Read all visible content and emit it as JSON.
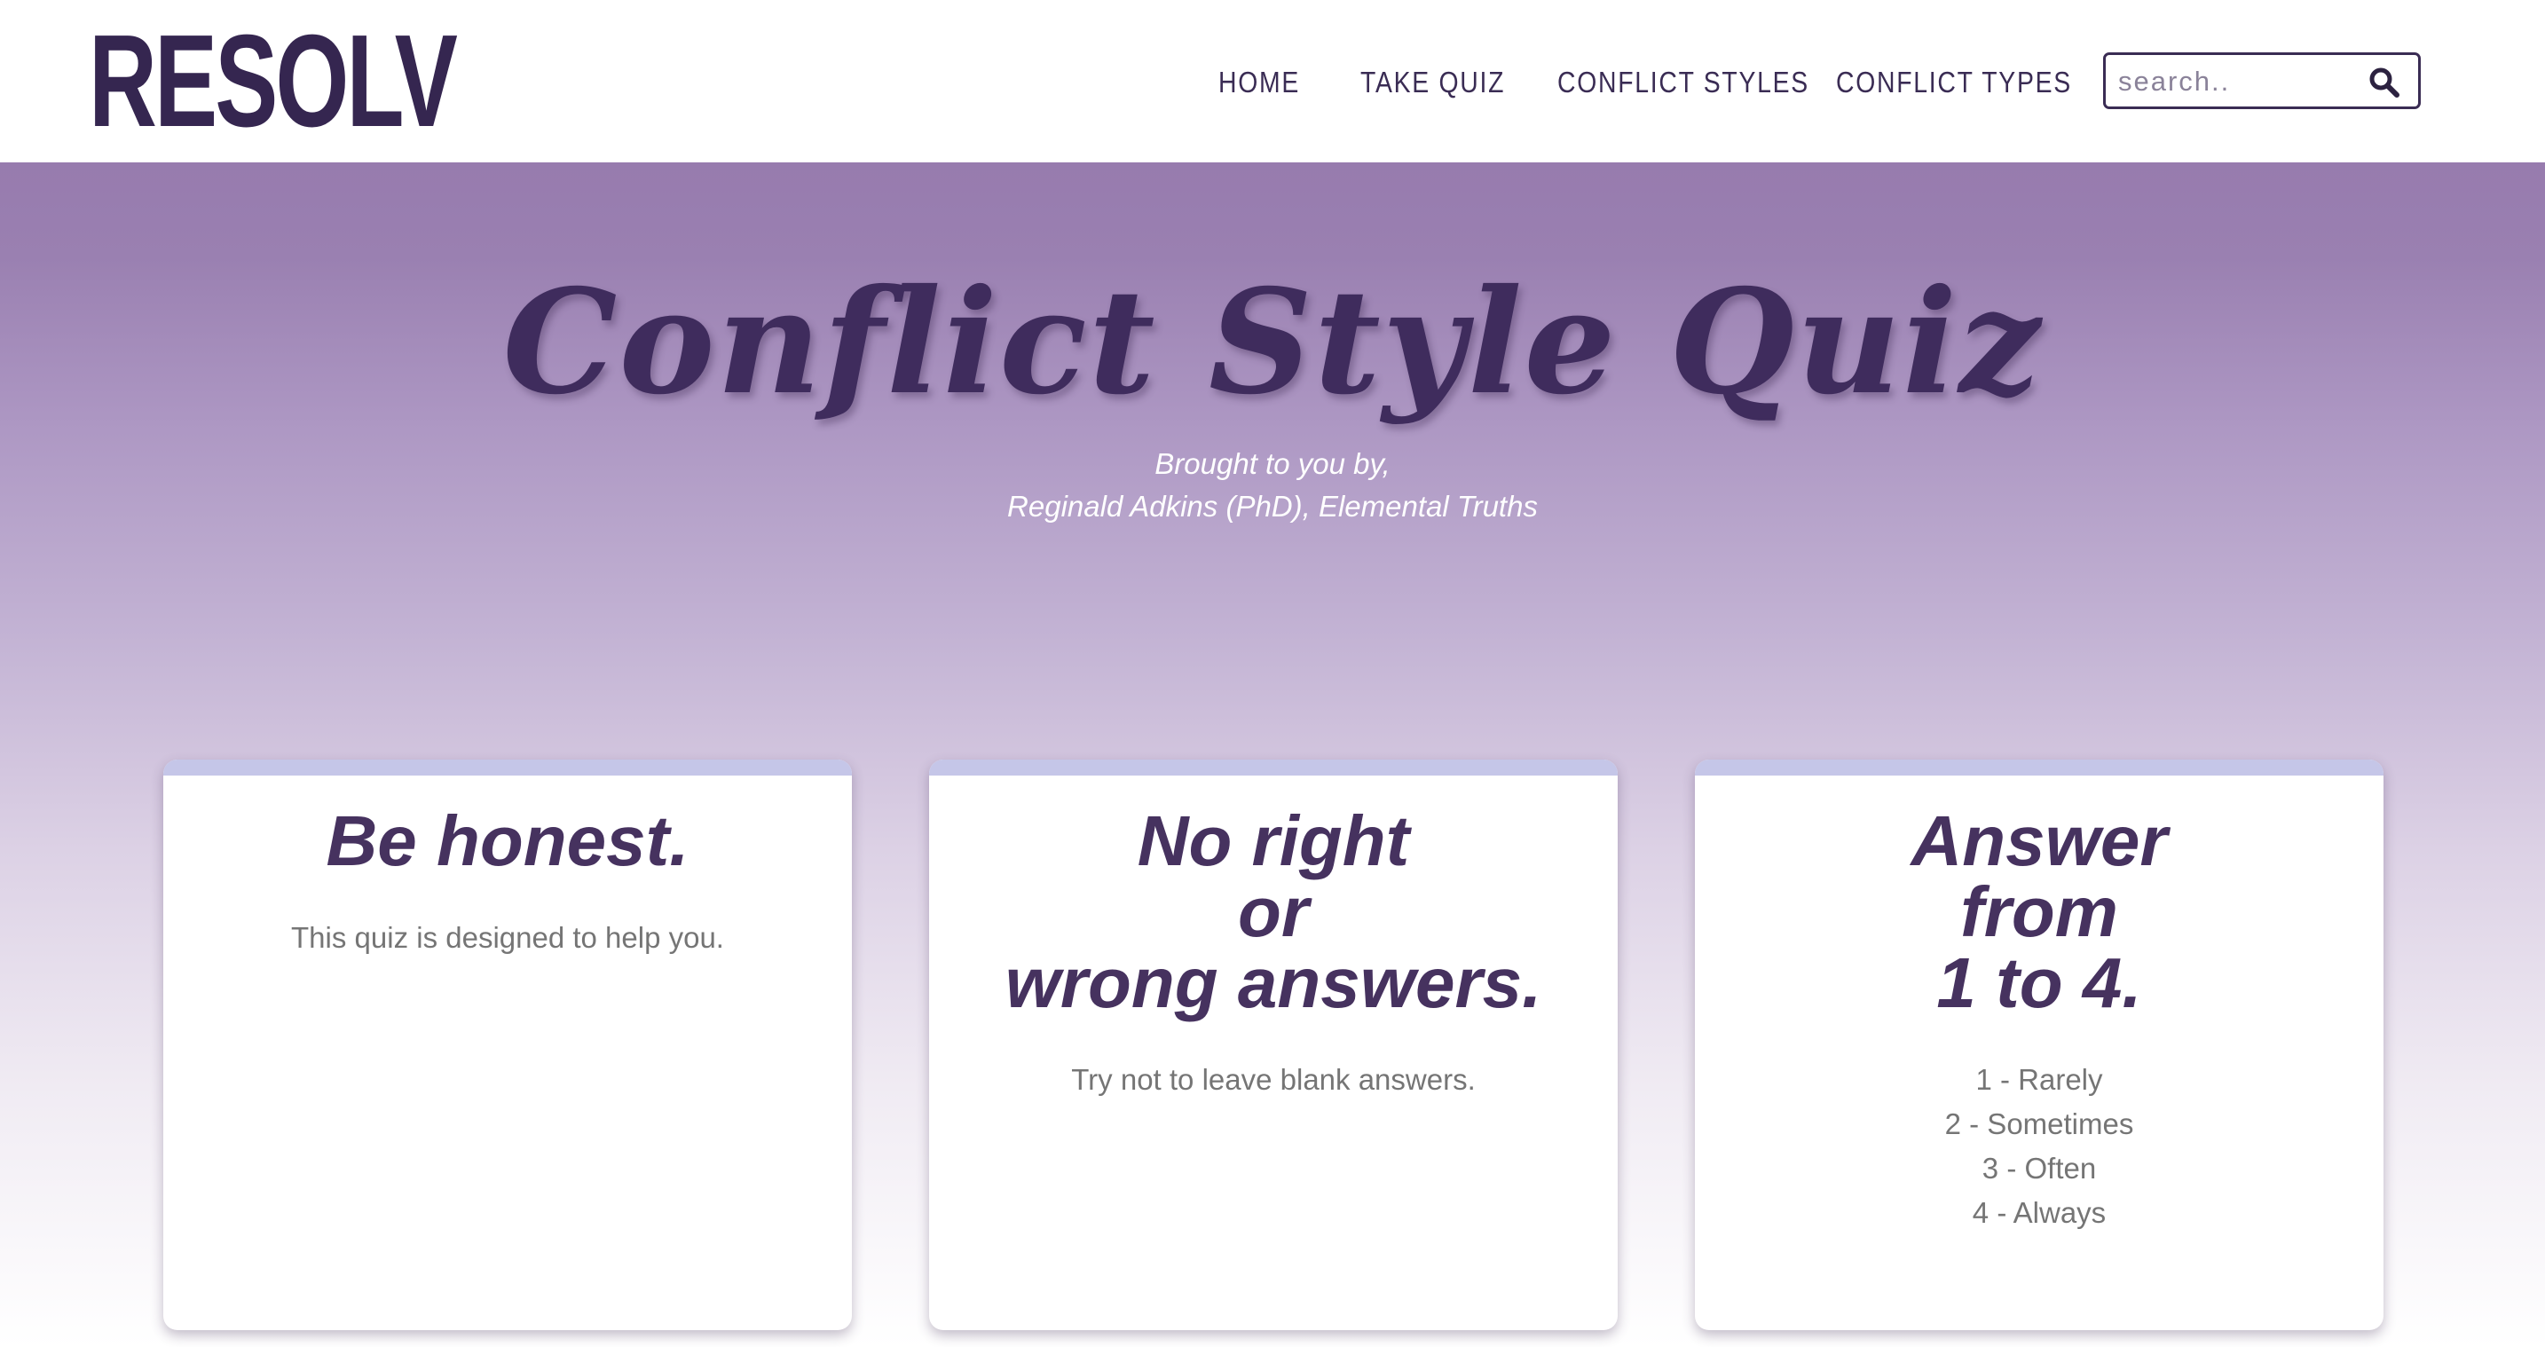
{
  "header": {
    "logo": "RESOLV",
    "nav": [
      {
        "label": "HOME"
      },
      {
        "label": "TAKE QUIZ"
      },
      {
        "label": "CONFLICT STYLES"
      },
      {
        "label": "CONFLICT TYPES"
      }
    ],
    "search": {
      "placeholder": "search..",
      "value": "",
      "icon": "search-icon"
    }
  },
  "hero": {
    "title": "Conflict Style Quiz",
    "byline": [
      "Brought to you by,",
      "Reginald Adkins (PhD), Elemental Truths"
    ]
  },
  "cards": [
    {
      "heading_lines": [
        "Be honest."
      ],
      "text": "This quiz is designed to help you."
    },
    {
      "heading_lines": [
        "No right",
        "or",
        "wrong answers."
      ],
      "text": "Try not to leave blank answers."
    },
    {
      "heading_lines": [
        "Answer",
        "from",
        "1 to 4."
      ],
      "scale": [
        "1 - Rarely",
        "2 - Sometimes",
        "3 - Often",
        "4 - Always"
      ]
    }
  ],
  "colors": {
    "brand": "#352650",
    "heading": "#46325f",
    "card_top_bar": "#c5c6e8",
    "hero_top": "#977bae",
    "body_text": "#757575"
  }
}
